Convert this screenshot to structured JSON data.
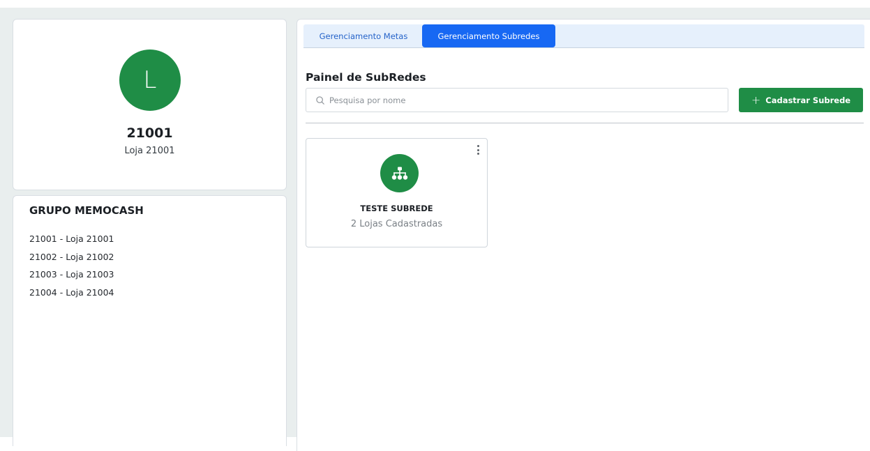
{
  "profile": {
    "avatar_letter": "L",
    "store_code": "21001",
    "store_name": "Loja 21001"
  },
  "group": {
    "title": "GRUPO MEMOCASH",
    "stores": [
      "21001 - Loja 21001",
      "21002 - Loja 21002",
      "21003 - Loja 21003",
      "21004 - Loja 21004"
    ]
  },
  "tabs": [
    {
      "label": "Gerenciamento Metas",
      "active": false
    },
    {
      "label": "Gerenciamento Subredes",
      "active": true
    }
  ],
  "panel": {
    "title": "Painel de SubRedes",
    "search_placeholder": "Pesquisa por nome",
    "add_button_label": "Cadastrar Subrede"
  },
  "subredes": [
    {
      "name": "TESTE SUBREDE",
      "count_label": "2 Lojas Cadastradas",
      "icon": "network-icon"
    }
  ],
  "colors": {
    "brand_green": "#1f8d46",
    "tab_active": "#1768f3",
    "tab_bar": "#e6f0fc",
    "background": "#e9eeee"
  }
}
